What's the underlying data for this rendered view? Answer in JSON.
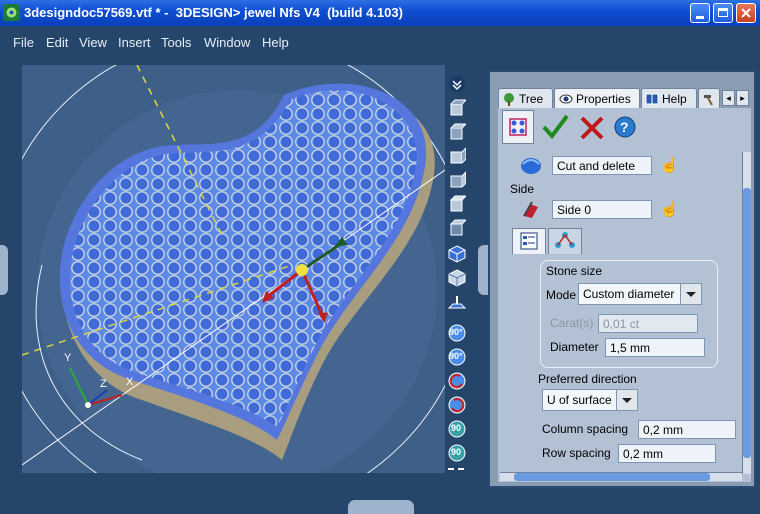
{
  "window": {
    "title": "3designdoc57569.vtf * -  3DESIGN> jewel Nfs V4  (build 4.103)"
  },
  "menu": [
    "File",
    "Edit",
    "View",
    "Insert",
    "Tools",
    "Window",
    "Help"
  ],
  "panel": {
    "tabs": [
      "Tree",
      "Properties",
      "Help"
    ],
    "operation_value": "Cut and delete",
    "side_label": "Side",
    "side_value": "Side 0",
    "stone_size": {
      "title": "Stone size",
      "mode_label": "Mode",
      "mode_value": "Custom diameter",
      "carat_label": "Carat(s)",
      "carat_value": "0,01 ct",
      "diameter_label": "Diameter",
      "diameter_value": "1,5 mm"
    },
    "preferred_direction": {
      "title": "Preferred direction",
      "value": "U of surface"
    },
    "column_spacing_label": "Column spacing",
    "column_spacing_value": "0,2 mm",
    "row_spacing_label": "Row spacing",
    "row_spacing_value": "0,2 mm"
  },
  "viewport": {
    "axis_labels": [
      "Y",
      "Z",
      "X"
    ],
    "toolbar_labels": [
      "90°",
      "90°",
      "90",
      "90"
    ]
  },
  "colors": {
    "titlebar": "#0f4fd3",
    "workspace": "#26456b",
    "viewport_bg": "#3e5f88",
    "heart_fill": "#4f7ae0",
    "panel_bg": "#8a9db3"
  }
}
